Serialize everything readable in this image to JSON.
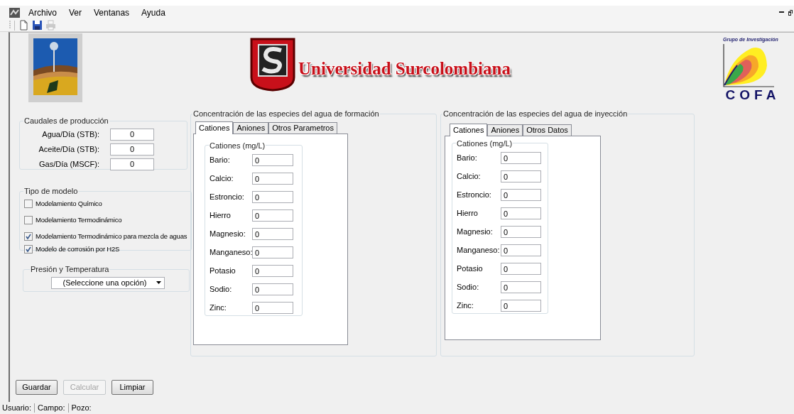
{
  "menu": [
    {
      "label": "Archivo"
    },
    {
      "label": "Ver"
    },
    {
      "label": "Ventanas"
    },
    {
      "label": "Ayuda"
    }
  ],
  "toolbar": [
    {
      "kind": "new",
      "disabled": false
    },
    {
      "kind": "save",
      "disabled": false
    },
    {
      "kind": "print",
      "disabled": true
    }
  ],
  "header": {
    "title": "Universidad Surcolombiana",
    "cofa_caption": "Grupo de Investigación",
    "cofa_name": "COFA"
  },
  "caudales": {
    "title": "Caudales de producción",
    "fields": [
      {
        "label": "Agua/Día (STB):",
        "value": "0"
      },
      {
        "label": "Aceite/Día (STB):",
        "value": "0"
      },
      {
        "label": "Gas/Día (MSCF):",
        "value": "0"
      }
    ]
  },
  "tipo_modelo": {
    "title": "Tipo de modelo",
    "options": [
      {
        "label": "Modelamiento Químico",
        "checked": false
      },
      {
        "label": "Modelamiento Termodinámico",
        "checked": false
      },
      {
        "label": "Modelamiento Termodinámico para mezcla de aguas",
        "checked": true
      },
      {
        "label": "Modelo de corrosión por H2S",
        "checked": true
      }
    ]
  },
  "presion": {
    "title": "Presión y Temperatura",
    "select": {
      "value": "(Seleccione una opción)"
    }
  },
  "panels": [
    {
      "title": "Concentración de las especies del agua de formación",
      "tabs": [
        {
          "label": "Cationes",
          "selected": true
        },
        {
          "label": "Aniones",
          "selected": false
        },
        {
          "label": "Otros Parametros",
          "selected": false
        }
      ],
      "group_title": "Cationes (mg/L)",
      "fields": [
        {
          "label": "Bario:",
          "value": "0"
        },
        {
          "label": "Calcio:",
          "value": "0"
        },
        {
          "label": "Estroncio:",
          "value": "0"
        },
        {
          "label": "Hierro",
          "value": "0"
        },
        {
          "label": "Magnesio:",
          "value": "0"
        },
        {
          "label": "Manganeso:",
          "value": "0"
        },
        {
          "label": "Potasio",
          "value": "0"
        },
        {
          "label": "Sodio:",
          "value": "0"
        },
        {
          "label": "Zinc:",
          "value": "0"
        }
      ]
    },
    {
      "title": "Concentración de las especies del agua de inyección",
      "tabs": [
        {
          "label": "Cationes",
          "selected": true
        },
        {
          "label": "Aniones",
          "selected": false
        },
        {
          "label": "Otros Datos",
          "selected": false
        }
      ],
      "group_title": "Cationes (mg/L)",
      "fields": [
        {
          "label": "Bario:",
          "value": "0"
        },
        {
          "label": "Calcio:",
          "value": "0"
        },
        {
          "label": "Estroncio:",
          "value": "0"
        },
        {
          "label": "Hierro",
          "value": "0"
        },
        {
          "label": "Magnesio:",
          "value": "0"
        },
        {
          "label": "Manganeso:",
          "value": "0"
        },
        {
          "label": "Potasio",
          "value": "0"
        },
        {
          "label": "Sodio:",
          "value": "0"
        },
        {
          "label": "Zinc:",
          "value": "0"
        }
      ]
    }
  ],
  "buttons": [
    {
      "label": "Guardar",
      "disabled": false
    },
    {
      "label": "Calcular",
      "disabled": true
    },
    {
      "label": "Limpiar",
      "disabled": false
    }
  ],
  "status_bar": [
    {
      "label": "Usuario:"
    },
    {
      "label": "Campo:"
    },
    {
      "label": "Pozo:"
    }
  ]
}
